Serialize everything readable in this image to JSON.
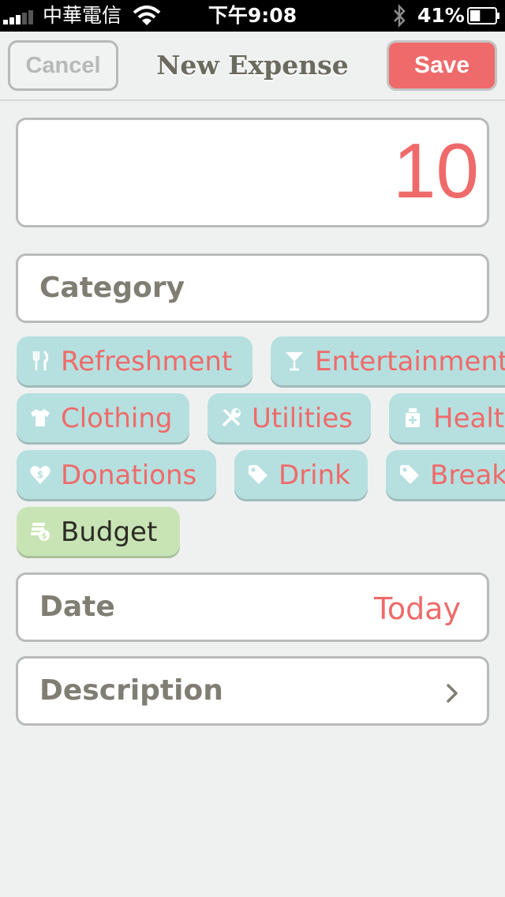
{
  "status_bar": {
    "carrier": "中華電信",
    "time": "下午9:08",
    "battery": "41%",
    "battery_level": 0.41
  },
  "nav": {
    "cancel_label": "Cancel",
    "title": "New Expense",
    "save_label": "Save"
  },
  "amount": {
    "value": "10"
  },
  "category": {
    "label": "Category",
    "chips": [
      {
        "label": "Refreshment",
        "icon": "utensils-icon"
      },
      {
        "label": "Entertainment",
        "icon": "cocktail-icon"
      },
      {
        "label": "Clothing",
        "icon": "tshirt-icon"
      },
      {
        "label": "Utilities",
        "icon": "tools-icon"
      },
      {
        "label": "Health",
        "icon": "medicine-bottle-icon"
      },
      {
        "label": "Donations",
        "icon": "heart-dollar-icon"
      },
      {
        "label": "Drink",
        "icon": "tag-icon"
      },
      {
        "label": "Breakfast",
        "icon": "tag-icon"
      },
      {
        "label": "Budget",
        "icon": "money-stack-icon"
      }
    ]
  },
  "date": {
    "label": "Date",
    "value": "Today"
  },
  "description": {
    "label": "Description"
  },
  "colors": {
    "accent": "#ef6a6a",
    "chip_background": "#b6e0df",
    "budget_chip_background": "#c8e4b5",
    "label_gray": "#807d73",
    "background": "#eff1f1"
  }
}
